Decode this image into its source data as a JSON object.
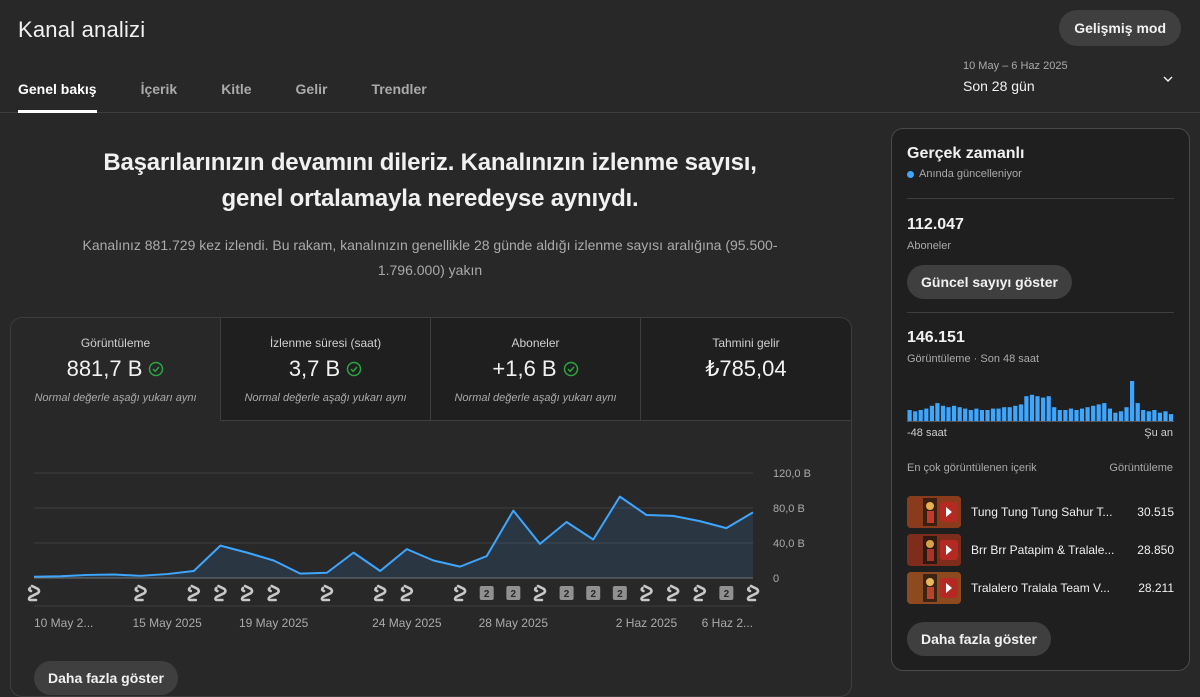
{
  "header": {
    "title": "Kanal analizi",
    "advanced_button": "Gelişmiş mod",
    "tabs": [
      {
        "label": "Genel bakış",
        "active": true
      },
      {
        "label": "İçerik"
      },
      {
        "label": "Kitle"
      },
      {
        "label": "Gelir"
      },
      {
        "label": "Trendler"
      }
    ],
    "date_range": "10 May – 6 Haz 2025",
    "date_label": "Son 28 gün"
  },
  "summary": {
    "headline_1": "Başarılarınızın devamını dileriz. Kanalınızın izlenme sayısı,",
    "headline_2": "genel ortalamayla neredeyse aynıydı.",
    "subtext_1": "Kanalınız 881.729 kez izlendi. Bu rakam, kanalınızın genellikle 28 günde aldığı izlenme sayısı aralığına (95.500-",
    "subtext_2": "1.796.000) yakın"
  },
  "metrics": [
    {
      "label": "Görüntüleme",
      "value": "881,7 B",
      "check": true,
      "note": "Normal değerle aşağı yukarı aynı"
    },
    {
      "label": "İzlenme süresi (saat)",
      "value": "3,7 B",
      "check": true,
      "note": "Normal değerle aşağı yukarı aynı"
    },
    {
      "label": "Aboneler",
      "value": "+1,6 B",
      "check": true,
      "note": "Normal değerle aşağı yukarı aynı"
    },
    {
      "label": "Tahmini gelir",
      "value": "₺785,04",
      "check": false,
      "note": ""
    }
  ],
  "chart_data": {
    "type": "area",
    "x_tick_labels": [
      "10 May 2...",
      "15 May 2025",
      "19 May 2025",
      "24 May 2025",
      "28 May 2025",
      "2 Haz 2025",
      "6 Haz 2..."
    ],
    "y_tick_labels": [
      "120,0 B",
      "80,0 B",
      "40,0 B",
      "0"
    ],
    "ylim": [
      0,
      120000
    ],
    "grid": true,
    "color": "#3ea6ff",
    "values": [
      1500,
      2000,
      3500,
      4000,
      2500,
      4500,
      8000,
      37000,
      29000,
      20000,
      5000,
      6000,
      29000,
      8000,
      33000,
      20000,
      13000,
      25000,
      77000,
      39000,
      64000,
      44000,
      93000,
      72000,
      71000,
      65000,
      57000,
      75000
    ],
    "upload_markers": [
      {
        "day": 1,
        "kind": "shorts"
      },
      {
        "day": 5,
        "kind": "shorts"
      },
      {
        "day": 7,
        "kind": "shorts"
      },
      {
        "day": 8,
        "kind": "shorts"
      },
      {
        "day": 9,
        "kind": "shorts"
      },
      {
        "day": 10,
        "kind": "shorts"
      },
      {
        "day": 12,
        "kind": "shorts"
      },
      {
        "day": 14,
        "kind": "shorts"
      },
      {
        "day": 15,
        "kind": "shorts"
      },
      {
        "day": 17,
        "kind": "shorts"
      },
      {
        "day": 18,
        "kind": "count",
        "count": "2"
      },
      {
        "day": 19,
        "kind": "count",
        "count": "2"
      },
      {
        "day": 20,
        "kind": "shorts"
      },
      {
        "day": 21,
        "kind": "count",
        "count": "2"
      },
      {
        "day": 22,
        "kind": "count",
        "count": "2"
      },
      {
        "day": 23,
        "kind": "count",
        "count": "2"
      },
      {
        "day": 24,
        "kind": "shorts"
      },
      {
        "day": 25,
        "kind": "shorts"
      },
      {
        "day": 26,
        "kind": "shorts"
      },
      {
        "day": 27,
        "kind": "count",
        "count": "2"
      },
      {
        "day": 28,
        "kind": "shorts"
      }
    ]
  },
  "show_more": "Daha fazla göster",
  "realtime": {
    "title": "Gerçek zamanlı",
    "live_text": "Anında güncelleniyor",
    "subscribers_value": "112.047",
    "subscribers_label": "Aboneler",
    "show_count_button": "Güncel sayıyı göster",
    "views_value": "146.151",
    "views_label": "Görüntüleme · Son 48 saat",
    "axis_left": "-48 saat",
    "axis_right": "Şu an",
    "hourly_bars": [
      8,
      7,
      8,
      9,
      11,
      13,
      11,
      10,
      11,
      10,
      9,
      8,
      9,
      8,
      8,
      9,
      9,
      10,
      10,
      11,
      12,
      18,
      19,
      18,
      17,
      18,
      10,
      8,
      8,
      9,
      8,
      9,
      10,
      11,
      12,
      13,
      9,
      6,
      7,
      10,
      29,
      13,
      8,
      7,
      8,
      6,
      7,
      5
    ],
    "top_content_header": "En çok görüntülenen içerik",
    "top_content_col": "Görüntüleme",
    "top_content": [
      {
        "title": "Tung Tung Tung Sahur T...",
        "views": "30.515"
      },
      {
        "title": "Brr Brr Patapim & Tralale...",
        "views": "28.850"
      },
      {
        "title": "Tralalero Tralala Team V...",
        "views": "28.211"
      }
    ],
    "show_more_button": "Daha fazla göster"
  },
  "colors": {
    "background": "#282828",
    "panel": "#1f1f1f",
    "accent": "#3ea6ff",
    "check": "#2ba640"
  }
}
